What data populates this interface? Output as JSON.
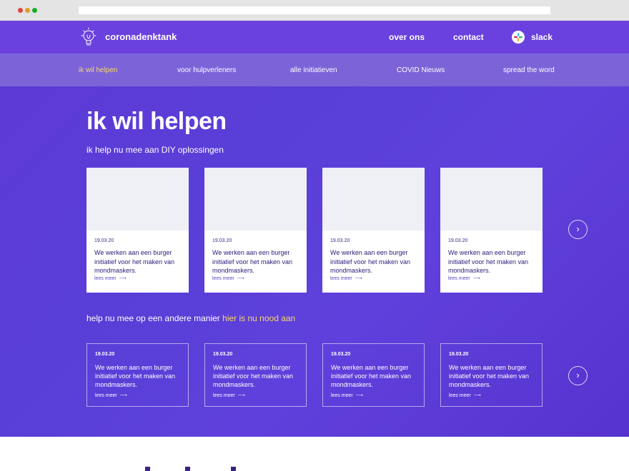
{
  "browser": {
    "url": ""
  },
  "header": {
    "logo_text": "coronadenktank",
    "nav": [
      "over ons",
      "contact",
      "slack"
    ]
  },
  "subnav": {
    "items": [
      "ik wil helpen",
      "voor hulpverleners",
      "alle initiatieven",
      "COVID Nieuws",
      "spread the word"
    ],
    "active_index": 0
  },
  "hero": {
    "title": "ik wil helpen",
    "subtitle": "ik help nu mee aan DIY oplossingen"
  },
  "cards": [
    {
      "date": "19.03.20",
      "text": "We werken aan een burger initiatief voor het maken van mondmaskers.",
      "more": "lees meer"
    },
    {
      "date": "19.03.20",
      "text": "We werken aan een burger initiatief voor het maken van mondmaskers.",
      "more": "lees meer"
    },
    {
      "date": "19.03.20",
      "text": "We werken aan een burger initiatief voor het maken van mondmaskers.",
      "more": "lees meer"
    },
    {
      "date": "19.03.20",
      "text": "We werken aan een burger initiatief voor het maken van mondmaskers.",
      "more": "lees meer"
    }
  ],
  "help_line": {
    "prefix": "help nu mee op een andere manier ",
    "highlight": "hier is nu nood aan"
  },
  "need_cards": [
    {
      "date": "19.03.20",
      "text": "We werken aan een burger initiatief voor het maken van mondmaskers.",
      "more": "lees meer"
    },
    {
      "date": "19.03.20",
      "text": "We werken aan een burger initiatief voor het maken van mondmaskers.",
      "more": "lees meer"
    },
    {
      "date": "19.03.20",
      "text": "We werken aan een burger initiatief voor het maken van mondmaskers.",
      "more": "lees meer"
    },
    {
      "date": "19.03.20",
      "text": "We werken aan een burger initiatief voor het maken van mondmaskers.",
      "more": "lees meer"
    }
  ],
  "icons": {
    "logo": "lightbulb-icon",
    "slack": "slack-icon",
    "next": "chevron-right-icon",
    "more_arrow": "arrow-right-icon"
  },
  "colors": {
    "primary": "#6a40de",
    "subnav": "#7c64d8",
    "accent": "#f7d96a",
    "card_text": "#2b1b78"
  }
}
